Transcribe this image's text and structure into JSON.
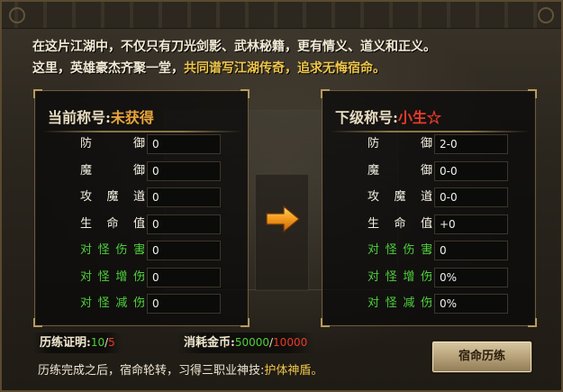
{
  "intro": {
    "line1": "在这片江湖中，不仅只有刀光剑影、武林秘籍，更有情义、道义和正义。",
    "line2_a": "这里，英雄豪杰齐聚一堂，",
    "line2_b": "共同谱写江湖传奇，追求无悔宿命。"
  },
  "current": {
    "title_label": "当前称号:",
    "title_value": "未获得",
    "stats": [
      {
        "label": "防 御",
        "value": "0",
        "green": false
      },
      {
        "label": "魔 御",
        "value": "0",
        "green": false
      },
      {
        "label": "攻魔道",
        "value": "0",
        "green": false
      },
      {
        "label": "生命值",
        "value": "0",
        "green": false
      },
      {
        "label": "对怪伤害",
        "value": "0",
        "green": true
      },
      {
        "label": "对怪增伤",
        "value": "0",
        "green": true
      },
      {
        "label": "对怪减伤",
        "value": "0",
        "green": true
      }
    ]
  },
  "next": {
    "title_label": "下级称号:",
    "title_value": "小生☆",
    "stats": [
      {
        "label": "防 御",
        "value": "2-0",
        "green": false
      },
      {
        "label": "魔 御",
        "value": "0-0",
        "green": false
      },
      {
        "label": "攻魔道",
        "value": "0-0",
        "green": false
      },
      {
        "label": "生命值",
        "value": "+0",
        "green": false
      },
      {
        "label": "对怪伤害",
        "value": "0",
        "green": true
      },
      {
        "label": "对怪增伤",
        "value": "0%",
        "green": true
      },
      {
        "label": "对怪减伤",
        "value": "0%",
        "green": true
      }
    ]
  },
  "certificate": {
    "label": "历练证明:",
    "have": "10",
    "sep": "/",
    "need": "5"
  },
  "cost": {
    "label": "消耗金币:",
    "have": "50000",
    "sep": "/",
    "need": "10000"
  },
  "footer": {
    "text": "历练完成之后，宿命轮转，习得三职业神技:",
    "skill": "护体神盾。"
  },
  "action_button": "宿命历练",
  "colors": {
    "gold": "#f0c64a",
    "green": "#4fd03c",
    "red": "#e83a2a",
    "orange_arrow": "#f39a1c"
  }
}
